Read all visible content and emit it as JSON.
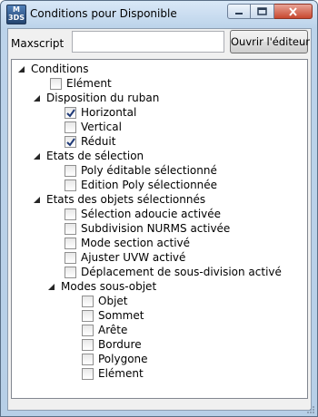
{
  "window": {
    "app_icon_label": "M 3DS",
    "title": "Conditions pour Disponible"
  },
  "toolbar": {
    "maxscript_label": "Maxscript",
    "maxscript_value": "",
    "open_editor_label": "Ouvrir l'éditeur"
  },
  "tree": {
    "root": "Conditions",
    "element": {
      "label": "Elément",
      "checked": false
    },
    "ribbon": {
      "label": "Disposition du ruban",
      "items": [
        {
          "label": "Horizontal",
          "checked": true
        },
        {
          "label": "Vertical",
          "checked": false
        },
        {
          "label": "Réduit",
          "checked": true
        }
      ]
    },
    "selection": {
      "label": "Etats de sélection",
      "items": [
        {
          "label": "Poly éditable sélectionné",
          "checked": false
        },
        {
          "label": "Edition Poly sélectionnée",
          "checked": false
        }
      ]
    },
    "objects": {
      "label": "Etats des objets sélectionnés",
      "items": [
        {
          "label": "Sélection adoucie activée",
          "checked": false
        },
        {
          "label": "Subdivision NURMS activée",
          "checked": false
        },
        {
          "label": "Mode section activé",
          "checked": false
        },
        {
          "label": "Ajuster UVW activé",
          "checked": false
        },
        {
          "label": "Déplacement de sous-division activé",
          "checked": false
        }
      ],
      "subobject": {
        "label": "Modes sous-objet",
        "items": [
          {
            "label": "Objet",
            "checked": false
          },
          {
            "label": "Sommet",
            "checked": false
          },
          {
            "label": "Arête",
            "checked": false
          },
          {
            "label": "Bordure",
            "checked": false
          },
          {
            "label": "Polygone",
            "checked": false
          },
          {
            "label": "Elément",
            "checked": false
          }
        ]
      }
    }
  }
}
